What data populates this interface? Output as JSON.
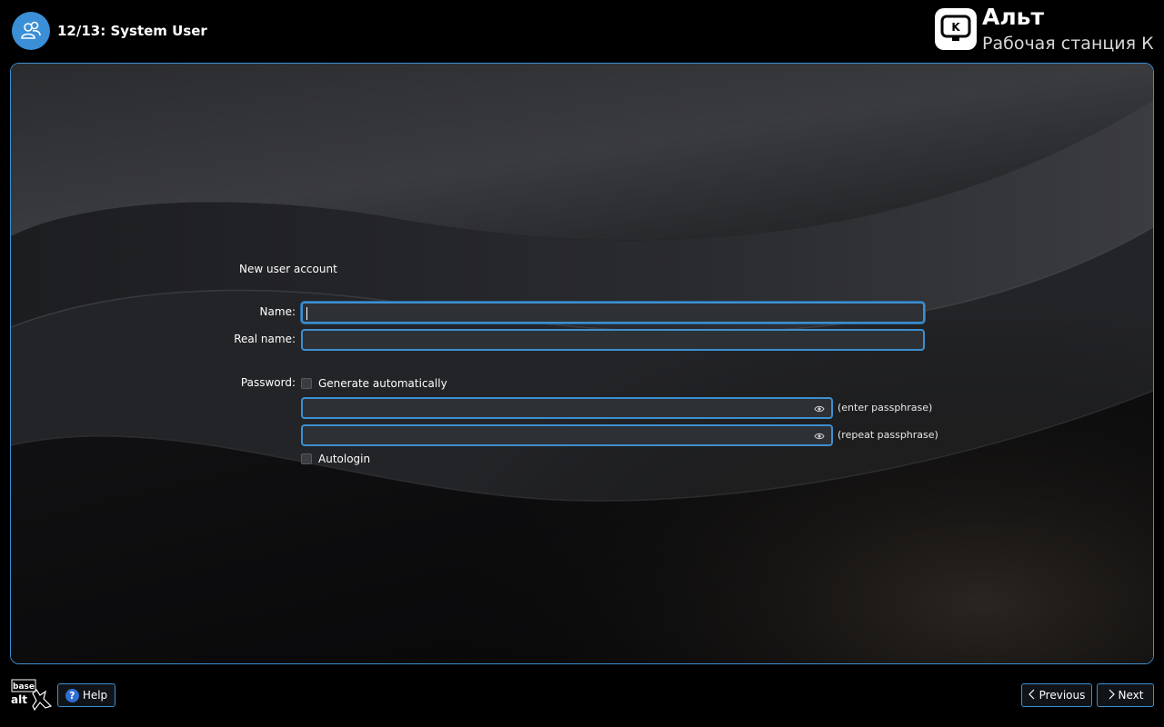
{
  "header": {
    "step_title": "12/13: System User",
    "step_icon": "users-icon",
    "brand_name": "Альт",
    "brand_edition": "Рабочая станция К",
    "brand_logo_letter": "K"
  },
  "form": {
    "section_title": "New user account",
    "name_label": "Name:",
    "name_value": "",
    "real_name_label": "Real name:",
    "real_name_value": "",
    "password_label": "Password:",
    "generate_label": "Generate automatically",
    "generate_checked": false,
    "pass_hint": "(enter passphrase)",
    "repeat_hint": "(repeat passphrase)",
    "autologin_label": "Autologin",
    "autologin_checked": false
  },
  "footer": {
    "logo_top": "base",
    "logo_bottom": "alt",
    "help_label": "Help",
    "previous_label": "Previous",
    "next_label": "Next"
  },
  "colors": {
    "accent": "#3d8fd0",
    "field_bg": "#2d3035",
    "step_icon_bg": "#3a8fd6"
  }
}
